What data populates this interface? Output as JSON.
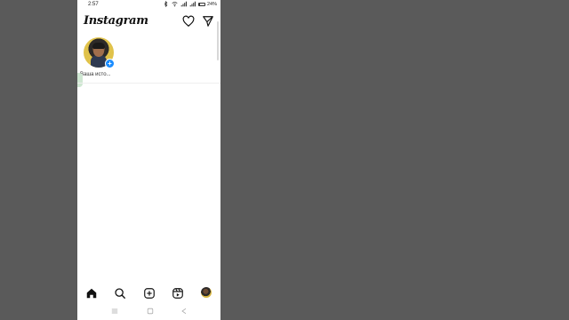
{
  "statusbar": {
    "time": "2:57",
    "battery_pct": "24%",
    "battery_level": 0.24,
    "icons": [
      "bluetooth-icon",
      "wifi-icon",
      "signal-icon",
      "signal-icon",
      "battery-icon"
    ]
  },
  "header": {
    "logo": "Instagram",
    "icons": [
      "heart-icon",
      "send-icon"
    ]
  },
  "stories": [
    {
      "label": "Ваша исто...",
      "add_icon": "+",
      "icons": [
        "avatar",
        "plus-icon"
      ]
    }
  ],
  "bottom_nav": {
    "items": [
      "home-icon",
      "search-icon",
      "create-icon",
      "reels-icon",
      "profile-avatar"
    ]
  },
  "system_nav": {
    "items": [
      "menu-icon",
      "home-square-icon",
      "back-icon"
    ]
  },
  "colors": {
    "background": "#5a5a5a",
    "surface": "#ffffff",
    "accent": "#1a8cff"
  }
}
